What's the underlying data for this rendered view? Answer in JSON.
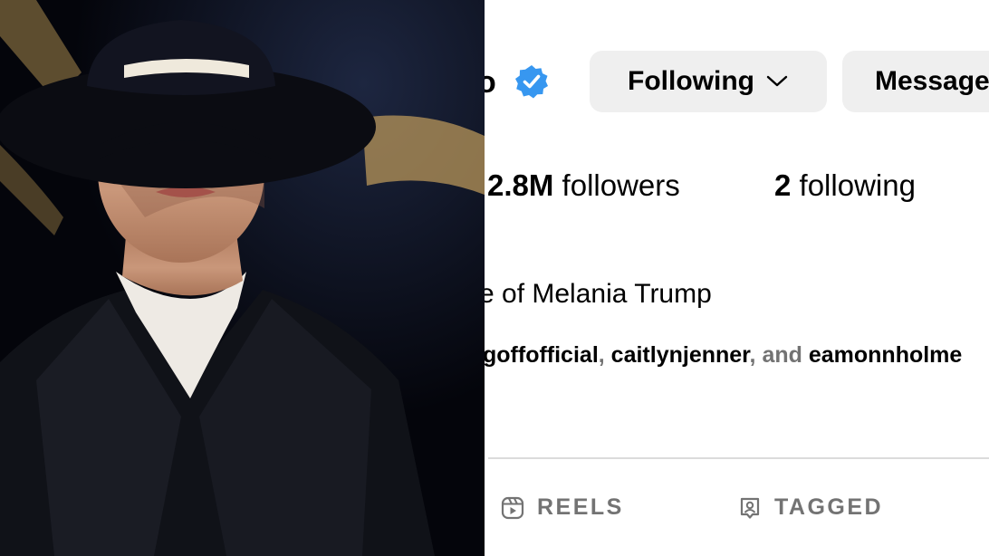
{
  "profile": {
    "username_fragment": "o",
    "follow_button_label": "Following",
    "message_button_label": "Message",
    "followers_count": "2.8M",
    "followers_label": " followers",
    "following_count": "2",
    "following_label": " following",
    "bio_fragment": "e of Melania Trump",
    "mutual": {
      "names": [
        "goffofficial",
        "caitlynjenner",
        "eamonnholme"
      ],
      "separator": ", ",
      "conjunction": "and"
    }
  },
  "tabs": {
    "reels": "REELS",
    "tagged": "TAGGED"
  },
  "colors": {
    "verified_badge": "#3797f0",
    "button_bg": "#efefef",
    "muted_text": "#737373",
    "divider": "#dbdbdb"
  },
  "icons": {
    "verified": "verified-badge-icon",
    "chevron": "chevron-down-icon",
    "reels": "reels-icon",
    "tagged": "tagged-icon"
  }
}
